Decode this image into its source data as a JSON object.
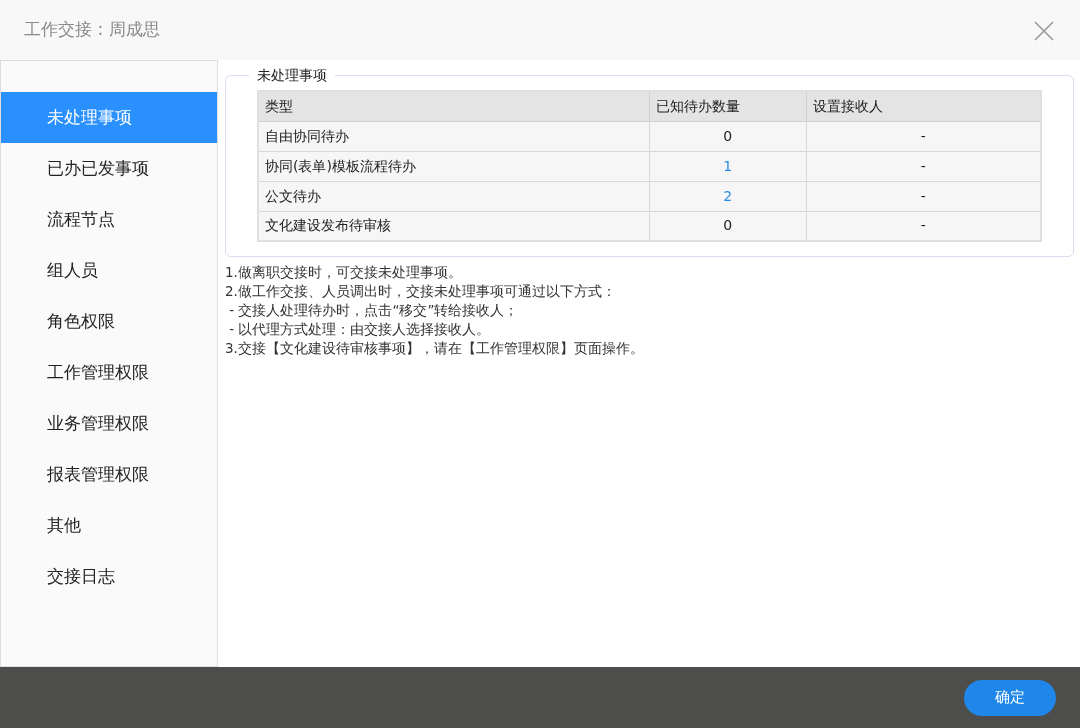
{
  "window": {
    "title": "工作交接 : 周成思"
  },
  "sidebar": {
    "items": [
      {
        "label": "未处理事项",
        "selected": true
      },
      {
        "label": "已办已发事项",
        "selected": false
      },
      {
        "label": "流程节点",
        "selected": false
      },
      {
        "label": "组人员",
        "selected": false
      },
      {
        "label": "角色权限",
        "selected": false
      },
      {
        "label": "工作管理权限",
        "selected": false
      },
      {
        "label": "业务管理权限",
        "selected": false
      },
      {
        "label": "报表管理权限",
        "selected": false
      },
      {
        "label": "其他",
        "selected": false
      },
      {
        "label": "交接日志",
        "selected": false
      }
    ]
  },
  "section": {
    "legend": "未处理事项",
    "table": {
      "columns": [
        "类型",
        "已知待办数量",
        "设置接收人"
      ],
      "rows": [
        {
          "type": "自由协同待办",
          "count": "0",
          "count_linked": false,
          "receiver": "-"
        },
        {
          "type": "协同(表单)模板流程待办",
          "count": "1",
          "count_linked": true,
          "receiver": "-"
        },
        {
          "type": "公文待办",
          "count": "2",
          "count_linked": true,
          "receiver": "-"
        },
        {
          "type": "文化建设发布待审核",
          "count": "0",
          "count_linked": false,
          "receiver": "-"
        }
      ]
    }
  },
  "notes": [
    "1.做离职交接时，可交接未处理事项。",
    "2.做工作交接、人员调出时，交接未处理事项可通过以下方式：",
    " - 交接人处理待办时，点击“移交”转给接收人；",
    " - 以代理方式处理：由交接人选择接收人。",
    "3.交接【文化建设待审核事项】，请在【工作管理权限】页面操作。"
  ],
  "footer": {
    "confirm": "确定"
  }
}
